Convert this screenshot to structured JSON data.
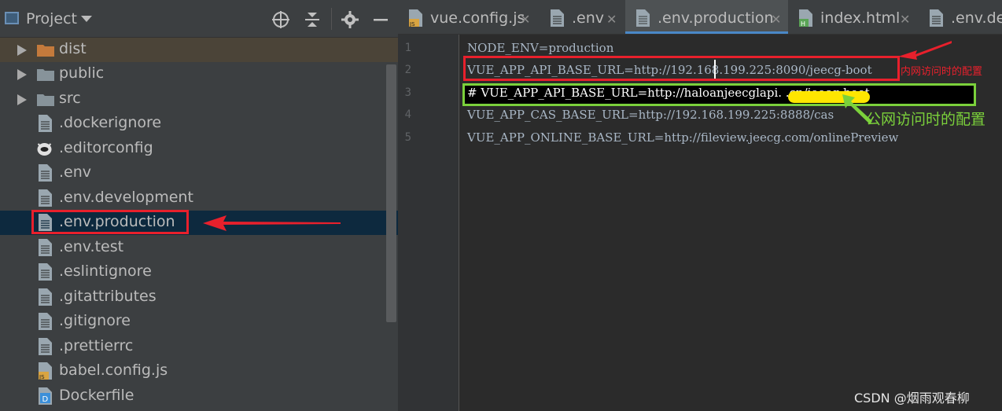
{
  "project_panel": {
    "title": "Project",
    "tools": [
      "locate-icon",
      "collapse-icon",
      "gear-icon",
      "minimize-icon"
    ],
    "tree": [
      {
        "label": "dist",
        "kind": "folder",
        "expandable": true,
        "color": "#c47a3c"
      },
      {
        "label": "public",
        "kind": "folder",
        "expandable": true,
        "color": "#87939a"
      },
      {
        "label": "src",
        "kind": "folder",
        "expandable": true,
        "color": "#87939a"
      },
      {
        "label": ".dockerignore",
        "kind": "file"
      },
      {
        "label": ".editorconfig",
        "kind": "editorconfig"
      },
      {
        "label": ".env",
        "kind": "file"
      },
      {
        "label": ".env.development",
        "kind": "file"
      },
      {
        "label": ".env.production",
        "kind": "file",
        "selected": true
      },
      {
        "label": ".env.test",
        "kind": "file"
      },
      {
        "label": ".eslintignore",
        "kind": "file"
      },
      {
        "label": ".gitattributes",
        "kind": "file"
      },
      {
        "label": ".gitignore",
        "kind": "file"
      },
      {
        "label": ".prettierrc",
        "kind": "file"
      },
      {
        "label": "babel.config.js",
        "kind": "js"
      },
      {
        "label": "Dockerfile",
        "kind": "docker"
      }
    ]
  },
  "editor": {
    "tabs": [
      {
        "label": "vue.config.js",
        "icon": "js-file-icon"
      },
      {
        "label": ".env",
        "icon": "text-file-icon"
      },
      {
        "label": ".env.production",
        "icon": "text-file-icon",
        "active": true
      },
      {
        "label": "index.html",
        "icon": "html-file-icon"
      },
      {
        "label": ".env.dev",
        "icon": "text-file-icon"
      }
    ],
    "line_numbers": [
      "1",
      "2",
      "3",
      "4",
      "5"
    ],
    "lines": [
      "NODE_ENV=production",
      "VUE_APP_API_BASE_URL=http://192.168.199.225:8090/jeecg-boot",
      "# VUE_APP_API_BASE_URL=http://haloanjeecglapi.            .cn/jeecg-boot",
      "VUE_APP_CAS_BASE_URL=http://192.168.199.225:8888/cas",
      "VUE_APP_ONLINE_BASE_URL=http://fileview.jeecg.com/onlinePreview"
    ]
  },
  "annotations": {
    "intranet_note": "内网访问时的配置",
    "public_note": "公网访问时的配置",
    "red_color": "#e8202c",
    "green_color": "#7bd13b"
  },
  "watermark": "CSDN @烟雨观春柳"
}
